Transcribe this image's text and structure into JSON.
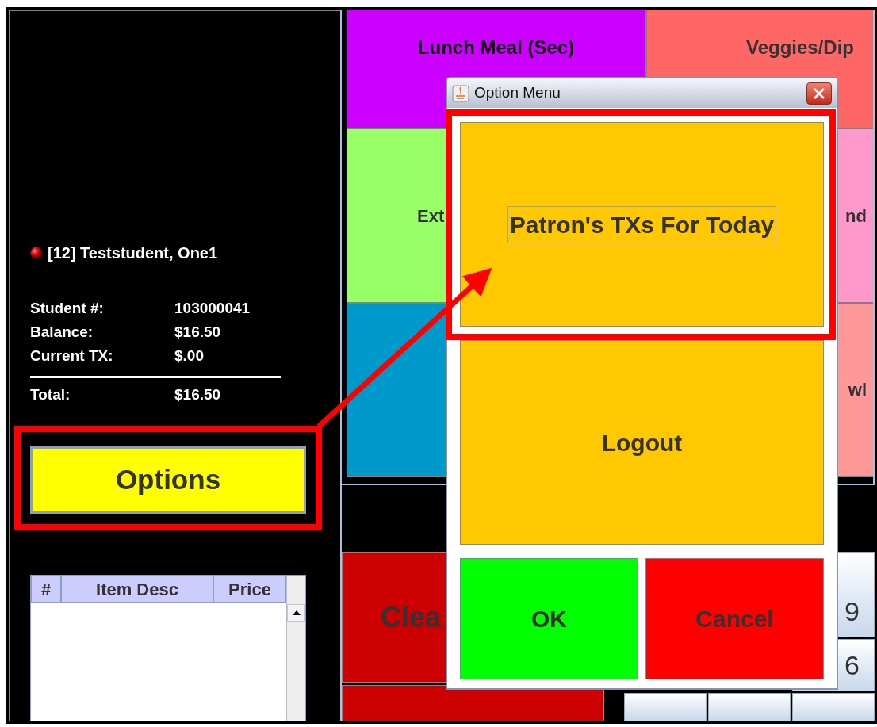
{
  "left_panel": {
    "student": "[12] Teststudent, One1",
    "info_rows": [
      {
        "label": "Student #:",
        "value": "103000041"
      },
      {
        "label": "Balance:",
        "value": "$16.50"
      },
      {
        "label": "Current TX:",
        "value": "$.00"
      }
    ],
    "total": {
      "label": "Total:",
      "value": "$16.50"
    },
    "options_button": "Options",
    "item_table": {
      "columns": [
        "#",
        "Item Desc",
        "Price"
      ]
    }
  },
  "menu_tiles": [
    {
      "label": "Lunch Meal (Sec)",
      "color": "#cc00ff"
    },
    {
      "label": "Veggies/Dip",
      "color": "#ff6666"
    },
    {
      "label": "Ext",
      "color": "#99ff66"
    },
    {
      "label": "nd",
      "color": "#ff99cc"
    },
    {
      "color": "#0099cc"
    },
    {
      "label": "wl",
      "color": "#ff9999"
    }
  ],
  "action_tiles": [
    {
      "label": "Clea"
    }
  ],
  "keypad_rows": [
    {
      "label": "9"
    },
    {
      "label": "6"
    }
  ],
  "dialog": {
    "title": "Option Menu",
    "buttons": [
      {
        "label": "Patron's TXs For Today",
        "color": "#ffc800",
        "focused": true
      },
      {
        "label": "Logout",
        "color": "#ffc800",
        "focused": false
      },
      {
        "label": "OK",
        "color": "#00ff00",
        "focused": false
      },
      {
        "label": "Cancel",
        "color": "#ff0000",
        "focused": false
      }
    ]
  }
}
